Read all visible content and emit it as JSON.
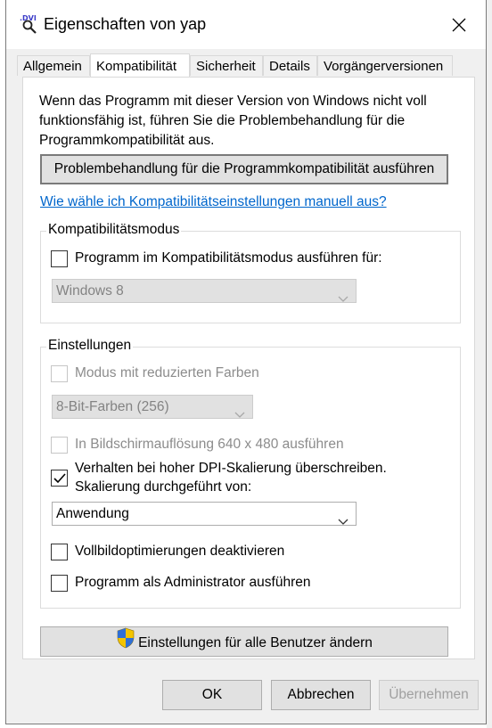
{
  "window": {
    "title": "Eigenschaften von yap"
  },
  "tabs": [
    {
      "label": "Allgemein"
    },
    {
      "label": "Kompatibilität"
    },
    {
      "label": "Sicherheit"
    },
    {
      "label": "Details"
    },
    {
      "label": "Vorgängerversionen"
    }
  ],
  "intro_text": "Wenn das Programm mit dieser Version von Windows nicht voll funktionsfähig ist, führen Sie die Problembehandlung für die Programmkompatibilität aus.",
  "troubleshoot_button": "Problembehandlung für die Programmkompatibilität ausführen",
  "manual_link": "Wie wähle ich Kompatibilitätseinstellungen manuell aus?",
  "compat_group": {
    "legend": "Kompatibilitätsmodus",
    "checkbox_label": "Programm im Kompatibilitätsmodus ausführen für:",
    "checked": false,
    "os_select_value": "Windows 8"
  },
  "settings_group": {
    "legend": "Einstellungen",
    "reduced_color": {
      "label": "Modus mit reduzierten Farben",
      "checked": false
    },
    "color_select_value": "8-Bit-Farben (256)",
    "resolution": {
      "label": "In Bildschirmauflösung 640 x 480 ausführen",
      "checked": false
    },
    "dpi_override": {
      "label_line1": "Verhalten bei hoher DPI-Skalierung überschreiben.",
      "label_line2": "Skalierung durchgeführt von:",
      "checked": true
    },
    "dpi_select_value": "Anwendung",
    "fullscreen_opt": {
      "label": "Vollbildoptimierungen deaktivieren",
      "checked": false
    },
    "run_as_admin": {
      "label": "Programm als Administrator ausführen",
      "checked": false
    }
  },
  "all_users_button": "Einstellungen für alle Benutzer ändern",
  "footer": {
    "ok": "OK",
    "cancel": "Abbrechen",
    "apply": "Übernehmen"
  },
  "colors": {
    "link": "#0066cc",
    "disabled_text": "#8c8c8c",
    "button_face": "#e1e1e1"
  },
  "icons": [
    "app-icon",
    "close-icon",
    "chevron-down-icon",
    "checkmark-icon",
    "uac-shield-icon"
  ]
}
